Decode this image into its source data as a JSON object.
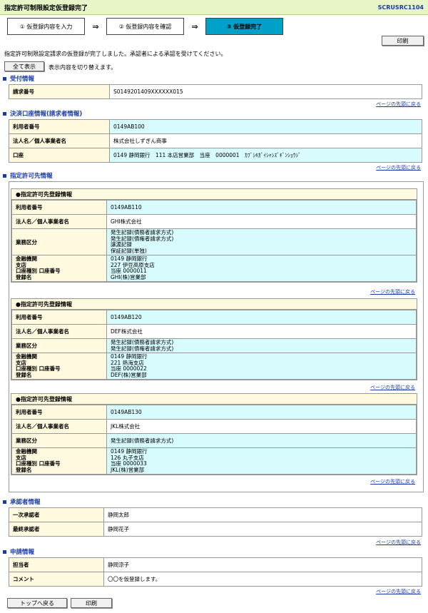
{
  "header": {
    "title": "指定許可制限設定仮登録完了",
    "screen_id": "SCRUSRC1104"
  },
  "steps": [
    "① 仮登録内容を入力",
    "② 仮登録内容を確認",
    "③ 仮登録完了"
  ],
  "print_label": "印刷",
  "message": "指定許可制限設定請求の仮登録が完了しました。承認者による承認を受けてください。",
  "show_all": {
    "label": "全て表示",
    "note": "表示内容を切り替えます。"
  },
  "back_top_link": "ページの先頭に戻る",
  "reception": {
    "title": "受付情報",
    "rows": [
      {
        "label": "請求番号",
        "value": "S0149201409XXXXXX015"
      }
    ]
  },
  "account": {
    "title": "決済口座情報(請求者情報)",
    "rows": [
      {
        "label": "利用者番号",
        "value": "0149AB100"
      },
      {
        "label": "法人名／個人事業者名",
        "value": "株式会社しずぎん商事"
      },
      {
        "label": "口座",
        "value": "0149 静岡銀行　111 本店営業部　当座　0000001　ｶﾌﾞｼｷｶﾞｲｼｬｼｽﾞｷﾞﾝｼｮｳｼﾞ"
      }
    ]
  },
  "permit": {
    "title": "指定許可先情報",
    "box_title": "●指定許可先登録情報",
    "labels": {
      "user_no": "利用者番号",
      "name": "法人名／個人事業者名",
      "biz": "業務区分",
      "bank": "金融機関",
      "branch": "支店",
      "acct": "口座種別 口座番号",
      "holder": "登録名"
    },
    "entries": [
      {
        "user_no": "0149AB110",
        "name": "GHI株式会社",
        "biz": [
          "発生記録(債務者請求方式)",
          "発生記録(債権者請求方式)",
          "譲渡記録",
          "保証記録(単独)"
        ],
        "bank": "0149 静岡銀行",
        "branch": "227 伊豆高原支店",
        "acct": "当座 0000011",
        "holder": "GHI(株)営業部"
      },
      {
        "user_no": "0149AB120",
        "name": "DEF株式会社",
        "biz": [
          "発生記録(債務者請求方式)",
          "発生記録(債権者請求方式)"
        ],
        "bank": "0149 静岡銀行",
        "branch": "221 熱海支店",
        "acct": "当座 0000022",
        "holder": "DEF(株)営業部"
      },
      {
        "user_no": "0149AB130",
        "name": "JKL株式会社",
        "biz": [
          "発生記録(債務者請求方式)"
        ],
        "bank": "0149 静岡銀行",
        "branch": "126 丸子支店",
        "acct": "当座 0000033",
        "holder": "JKL(株)営業部"
      }
    ]
  },
  "approver": {
    "title": "承認者情報",
    "rows": [
      {
        "label": "一次承認者",
        "value": "静岡太郎"
      },
      {
        "label": "最終承認者",
        "value": "静岡花子"
      }
    ]
  },
  "application": {
    "title": "申請情報",
    "rows": [
      {
        "label": "担当者",
        "value": "静岡涼子"
      },
      {
        "label": "コメント",
        "value": "〇〇を仮登録します。"
      }
    ]
  },
  "bottom_buttons": {
    "top": "トップへ戻る",
    "print": "印刷"
  }
}
